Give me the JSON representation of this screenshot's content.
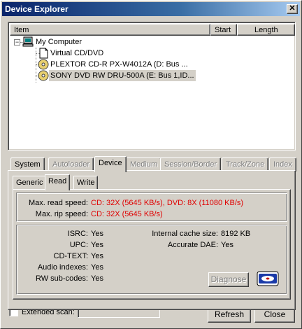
{
  "window": {
    "title": "Device Explorer",
    "close_glyph": "✕"
  },
  "listview": {
    "columns": [
      "Item",
      "Start",
      "Length"
    ],
    "nodes": [
      {
        "label": "My Computer",
        "icon": "computer-icon"
      },
      {
        "label": "Virtual CD/DVD",
        "icon": "virtual-drive-icon"
      },
      {
        "label": "PLEXTOR CD-R   PX-W4012A (D: Bus ...",
        "icon": "cd-drive-icon"
      },
      {
        "label": "SONY DVD RW DRU-500A (E: Bus 1,ID...",
        "icon": "dvd-drive-icon"
      }
    ]
  },
  "tabs": [
    "System",
    "Autoloader",
    "Device",
    "Medium",
    "Session/Border",
    "Track/Zone",
    "Index"
  ],
  "subtabs": [
    "Generic",
    "Read",
    "Write"
  ],
  "read_info": {
    "max_read_label": "Max. read speed:",
    "max_read_value": "CD: 32X (5645 KB/s), DVD: 8X (11080 KB/s)",
    "max_rip_label": "Max. rip speed:",
    "max_rip_value": "CD: 32X (5645 KB/s)"
  },
  "features": {
    "left": [
      {
        "label": "ISRC:",
        "value": "Yes"
      },
      {
        "label": "UPC:",
        "value": "Yes"
      },
      {
        "label": "CD-TEXT:",
        "value": "Yes"
      },
      {
        "label": "Audio indexes:",
        "value": "Yes"
      },
      {
        "label": "RW sub-codes:",
        "value": "Yes"
      }
    ],
    "right": [
      {
        "label": "Internal cache size:",
        "value": "8192 KB"
      },
      {
        "label": "Accurate DAE:",
        "value": "Yes"
      }
    ],
    "diagnose_label": "Diagnose"
  },
  "footer": {
    "extended_scan_label": "Extended scan:",
    "refresh_label": "Refresh",
    "close_label": "Close"
  },
  "colors": {
    "title_start": "#0a246a",
    "title_end": "#a6caf0",
    "value_red": "#e00000",
    "face": "#d4d0c8"
  }
}
